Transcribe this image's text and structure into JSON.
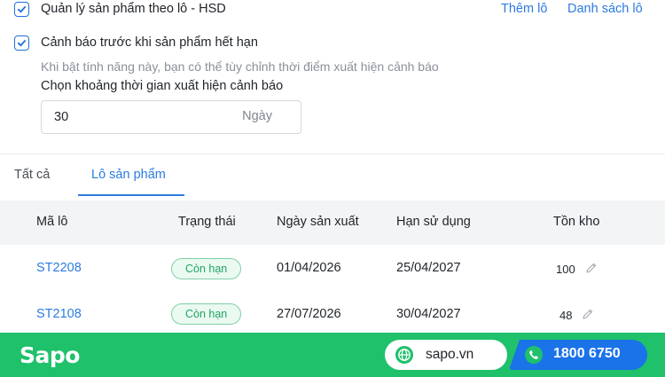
{
  "settings": {
    "batch_management_label": "Quản lý sản phẩm theo lô - HSD",
    "add_batch_link": "Thêm lô",
    "batch_list_link": "Danh sách lô",
    "expiry_warning_label": "Cảnh báo trước khi sản phẩm hết hạn",
    "expiry_warning_hint": "Khi bật tính năng này, bạn có thể tùy chỉnh thời điểm xuất hiện cảnh báo",
    "warning_period_label": "Chọn khoảng thời gian xuất hiện cảnh báo",
    "warning_period_value": "30",
    "warning_period_unit": "Ngày"
  },
  "tabs": [
    {
      "label": "Tất cả",
      "active": false
    },
    {
      "label": "Lô sản phẩm",
      "active": true
    }
  ],
  "table": {
    "headers": [
      "Mã lô",
      "Trạng thái",
      "Ngày sản xuất",
      "Hạn sử dụng",
      "Tồn kho"
    ],
    "rows": [
      {
        "code": "ST2208",
        "status": "Còn hạn",
        "mfg_date": "01/04/2026",
        "exp_date": "25/04/2027",
        "stock": "100"
      },
      {
        "code": "ST2108",
        "status": "Còn hạn",
        "mfg_date": "27/07/2026",
        "exp_date": "30/04/2027",
        "stock": "48"
      }
    ]
  },
  "footer": {
    "brand": "Sapo",
    "website": "sapo.vn",
    "hotline": "1800 6750"
  },
  "colors": {
    "accent": "#2b7be0",
    "checkbox": "#1f6fd6",
    "status_green": "#21a366",
    "footer_green": "#1fc16b",
    "hotline_blue": "#1a73e8"
  },
  "icons": {
    "checkbox": "checkmark-icon",
    "edit": "pencil-icon",
    "website": "globe-icon",
    "hotline": "phone-icon"
  }
}
